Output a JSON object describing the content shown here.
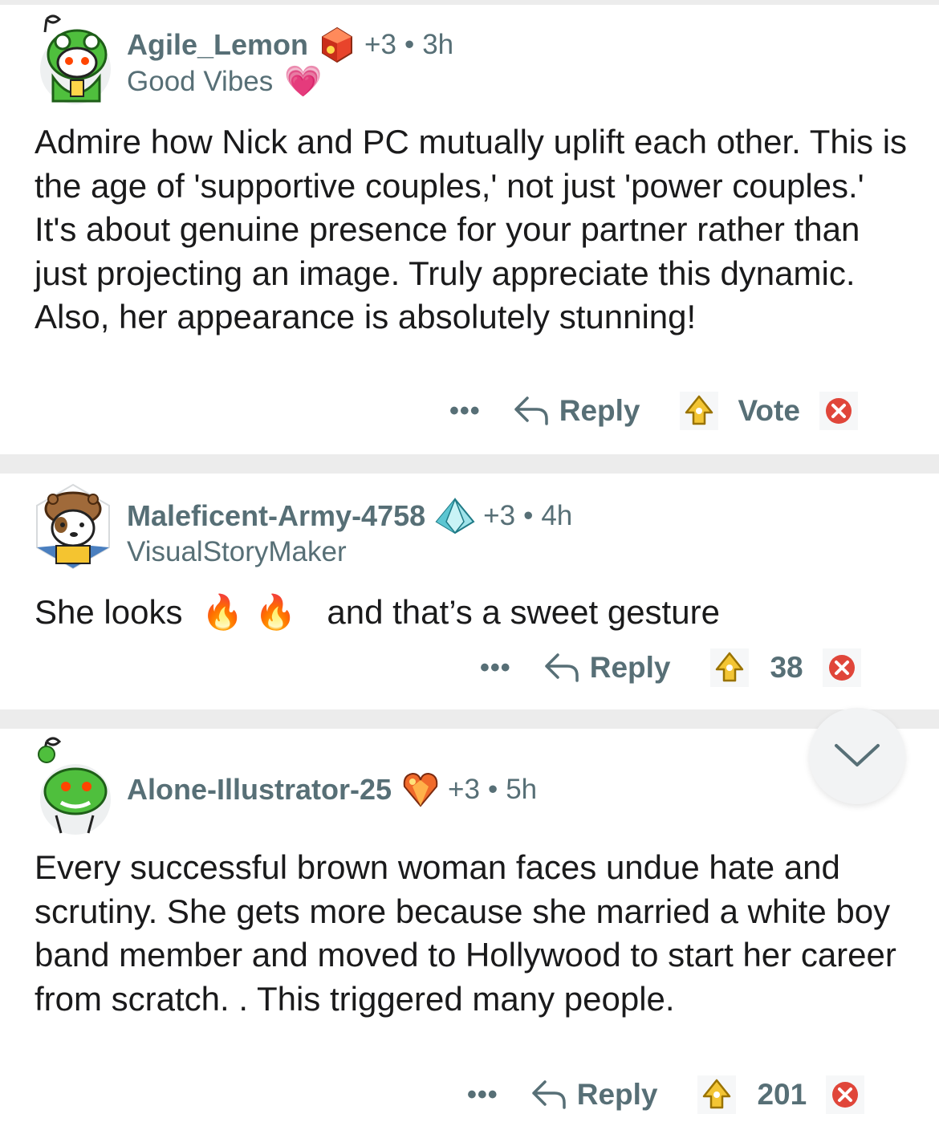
{
  "comments": [
    {
      "username": "Agile_Lemon",
      "award_extra": "+3",
      "separator": "•",
      "time": "3h",
      "flair_text": "Good Vibes",
      "flair_emoji": "💗",
      "body": "Admire how Nick and PC mutually uplift each other. This is the age of 'supportive couples,' not just 'power couples.' It's about genuine presence for your partner rather than just projecting an image. Truly appreciate this dynamic. Also, her appearance is absolutely stunning!",
      "more": "•••",
      "reply_label": "Reply",
      "score": "Vote",
      "avatar_icon": "snoo-frog-hoodie-avatar",
      "award_icon": "ruby-award-icon"
    },
    {
      "username": "Maleficent-Army-4758",
      "award_extra": "+3",
      "separator": "•",
      "time": "4h",
      "flair_text": "VisualStoryMaker",
      "body_part1": "She looks",
      "body_emojis": "🔥🔥",
      "body_part2": "and that’s a sweet gesture",
      "more": "•••",
      "reply_label": "Reply",
      "score": "38",
      "avatar_icon": "dog-bear-hat-avatar",
      "award_icon": "diamond-award-icon"
    },
    {
      "username": "Alone-Illustrator-25",
      "award_extra": "+3",
      "separator": "•",
      "time": "5h",
      "body": "Every successful brown woman faces undue hate and scrutiny. She gets more because she married a white boy band member and moved to Hollywood to start her career from scratch. . This triggered many people.",
      "more": "•••",
      "reply_label": "Reply",
      "score": "201",
      "avatar_icon": "snoo-green-alien-avatar",
      "award_icon": "heart-gem-award-icon"
    }
  ],
  "colors": {
    "meta": "#576f76",
    "text": "#1a1a1b",
    "separator": "#ececec",
    "vote_up": "#d8a400",
    "vote_down": "#e0463a"
  },
  "collapse_icon": "chevron-down-icon"
}
